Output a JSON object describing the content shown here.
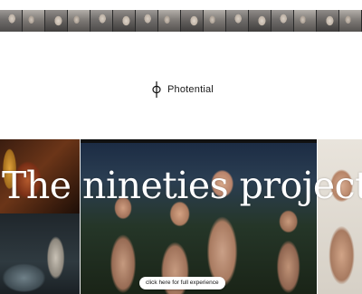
{
  "brand": {
    "logo_icon": "phi-icon",
    "name": "Photential"
  },
  "filmstrip": {
    "frame_count": 16
  },
  "hero": {
    "headline": "The nineties project",
    "cta_label": "click here for full experience"
  },
  "colors": {
    "background": "#ffffff",
    "headline": "#ffffff",
    "button_bg": "#ffffff",
    "button_text": "#111111"
  }
}
